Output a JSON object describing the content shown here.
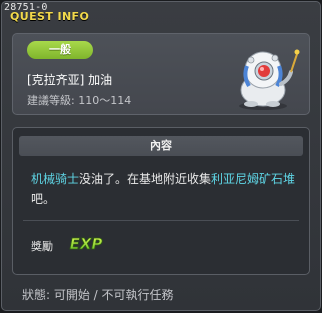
{
  "window": {
    "quest_id": "28751-0",
    "title": "QUEST INFO"
  },
  "quest": {
    "category_badge": "一般",
    "name": "[克拉齐亚] 加油",
    "level_requirement": "建議等級: 110～114",
    "npc_icon": "robot-npc-icon"
  },
  "content": {
    "header": "內容",
    "description_parts": {
      "highlight_1": "机械骑士",
      "text_1": "没油了。在基地附近收集",
      "highlight_2": "利亚尼姆矿石堆",
      "text_2": "吧。"
    }
  },
  "reward": {
    "label": "獎勵",
    "exp_icon_text": "EXP"
  },
  "status": {
    "text": "狀態: 可開始 / 不可執行任務"
  },
  "colors": {
    "title": "#f2d94c",
    "badge": "#8cc63f",
    "highlight": "#5fd6e6",
    "exp_gradient_top": "#e8ff5a",
    "exp_gradient_bottom": "#56b81e"
  }
}
